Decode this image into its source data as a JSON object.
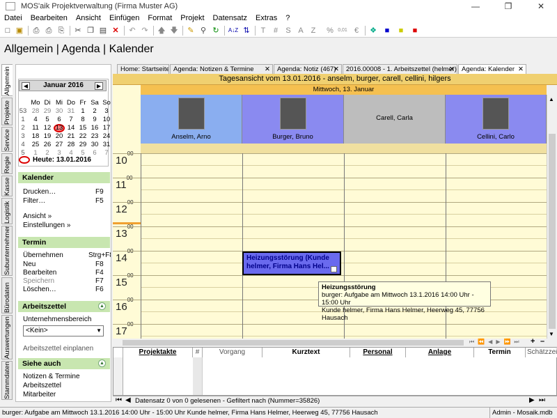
{
  "window": {
    "title": "MOS'aik Projektverwaltung (Firma Muster AG)"
  },
  "menu": [
    "Datei",
    "Bearbeiten",
    "Ansicht",
    "Einfügen",
    "Format",
    "Projekt",
    "Datensatz",
    "Extras",
    "?"
  ],
  "toolbar": {
    "icons": [
      "new-icon",
      "open-icon",
      "print-icon",
      "print-preview-icon",
      "preview-icon",
      "cut-icon",
      "copy-icon",
      "paste-icon",
      "delete-icon",
      "undo-icon",
      "redo-icon",
      "up-icon",
      "down-icon",
      "pen-icon",
      "find-icon",
      "refresh-icon",
      "sort-icon",
      "sort-desc-icon",
      "t-icon",
      "hash-icon",
      "s-icon",
      "a-icon",
      "z-icon",
      "percent-icon",
      "number-icon",
      "currency-icon",
      "puzzle-icon",
      "lock-blue-icon",
      "lock-yellow-icon",
      "lock-red-icon"
    ],
    "labels": {
      "sort": "A↓Z",
      "t": "T",
      "hash": "#",
      "s": "S",
      "a": "A",
      "z": "Z",
      "percent": "%",
      "num": "0,01",
      "cur": "€"
    }
  },
  "page_title": "Allgemein | Agenda | Kalender",
  "vtabs": [
    "Allgemein",
    "Projekte",
    "Service",
    "Regie",
    "Kasse",
    "Logistik",
    "Subunternehmer",
    "Bürodaten",
    "Auswertungen",
    "Stammdaten"
  ],
  "doc_tabs": [
    "Home: Startseite",
    "Agenda: Notizen & Termine",
    "Agenda: Notiz (467)",
    "2016.00008 - 1. Arbeitszettel (helmer)",
    "Agenda: Kalender"
  ],
  "minical": {
    "month": "Januar 2016",
    "weekdays": [
      "Mo",
      "Di",
      "Mi",
      "Do",
      "Fr",
      "Sa",
      "So"
    ],
    "weeks": [
      {
        "wk": "53",
        "days": [
          "28",
          "29",
          "30",
          "31",
          "1",
          "2",
          "3"
        ]
      },
      {
        "wk": "1",
        "days": [
          "4",
          "5",
          "6",
          "7",
          "8",
          "9",
          "10"
        ]
      },
      {
        "wk": "2",
        "days": [
          "11",
          "12",
          "13",
          "14",
          "15",
          "16",
          "17"
        ]
      },
      {
        "wk": "3",
        "days": [
          "18",
          "19",
          "20",
          "21",
          "22",
          "23",
          "24"
        ]
      },
      {
        "wk": "4",
        "days": [
          "25",
          "26",
          "27",
          "28",
          "29",
          "30",
          "31"
        ]
      },
      {
        "wk": "5",
        "days": [
          "1",
          "2",
          "3",
          "4",
          "5",
          "6",
          "7"
        ]
      }
    ],
    "today_label": "Heute: 13.01.2016"
  },
  "sections": {
    "kalender": {
      "title": "Kalender",
      "items": [
        {
          "label": "Drucken…",
          "key": "F9"
        },
        {
          "label": "Filter…",
          "key": "F5"
        }
      ],
      "links": [
        "Ansicht »",
        "Einstellungen »"
      ]
    },
    "termin": {
      "title": "Termin",
      "items": [
        {
          "label": "Übernehmen",
          "key": "Strg+F8"
        },
        {
          "label": "Neu",
          "key": "F8"
        },
        {
          "label": "Bearbeiten",
          "key": "F4"
        },
        {
          "label": "Speichern",
          "key": "F7"
        },
        {
          "label": "Löschen…",
          "key": "F6"
        }
      ]
    },
    "arbeitszettel": {
      "title": "Arbeitszettel",
      "area_label": "Unternehmensbereich",
      "select_value": "<Kein>",
      "link": "Arbeitszettel einplanen"
    },
    "siehe_auch": {
      "title": "Siehe auch",
      "links": [
        "Notizen & Termine",
        "Arbeitszettel",
        "Mitarbeiter"
      ]
    }
  },
  "day_view": {
    "title": "Tagesansicht vom 13.01.2016 - anselm, burger, carell, cellini, hilgers",
    "day_label": "Mittwoch, 13. Januar",
    "persons": [
      {
        "name": "Anselm, Arno",
        "color": "#8aaef0",
        "photo": true
      },
      {
        "name": "Burger, Bruno",
        "color": "#8a8af0",
        "photo": true
      },
      {
        "name": "Carell, Carla",
        "color": "#bdbdbd",
        "photo": false
      },
      {
        "name": "Cellini, Carlo",
        "color": "#8a8af0",
        "photo": true
      }
    ],
    "hours": [
      "10",
      "11",
      "12",
      "13",
      "14",
      "15",
      "16",
      "17"
    ],
    "hour_suffix": "00",
    "appointment": {
      "text": "Heizungsstörung (Kunde helmer, Firma Hans Hel..."
    },
    "tooltip": {
      "title": "Heizungsstörung",
      "line1": "burger: Aufgabe am Mittwoch 13.1.2016 14:00 Uhr - 15:00 Uhr",
      "line2": "Kunde helmer, Firma Hans Helmer, Heerweg 45, 77756 Hausach"
    }
  },
  "table": {
    "columns": [
      "Projektakte",
      "#",
      "Vorgang",
      "Kurztext",
      "Personal",
      "Anlage",
      "Termin",
      "Schätzzeit"
    ]
  },
  "record_nav": {
    "status": "Datensatz 0 von 0 gelesenen - Gefiltert nach (Nummer=35826)"
  },
  "statusbar": {
    "left": "burger: Aufgabe am Mittwoch 13.1.2016 14:00 Uhr - 15:00 Uhr Kunde helmer, Firma Hans Helmer, Heerweg 45, 77756 Hausach",
    "user": "Admin - Mosaik.mdb"
  }
}
